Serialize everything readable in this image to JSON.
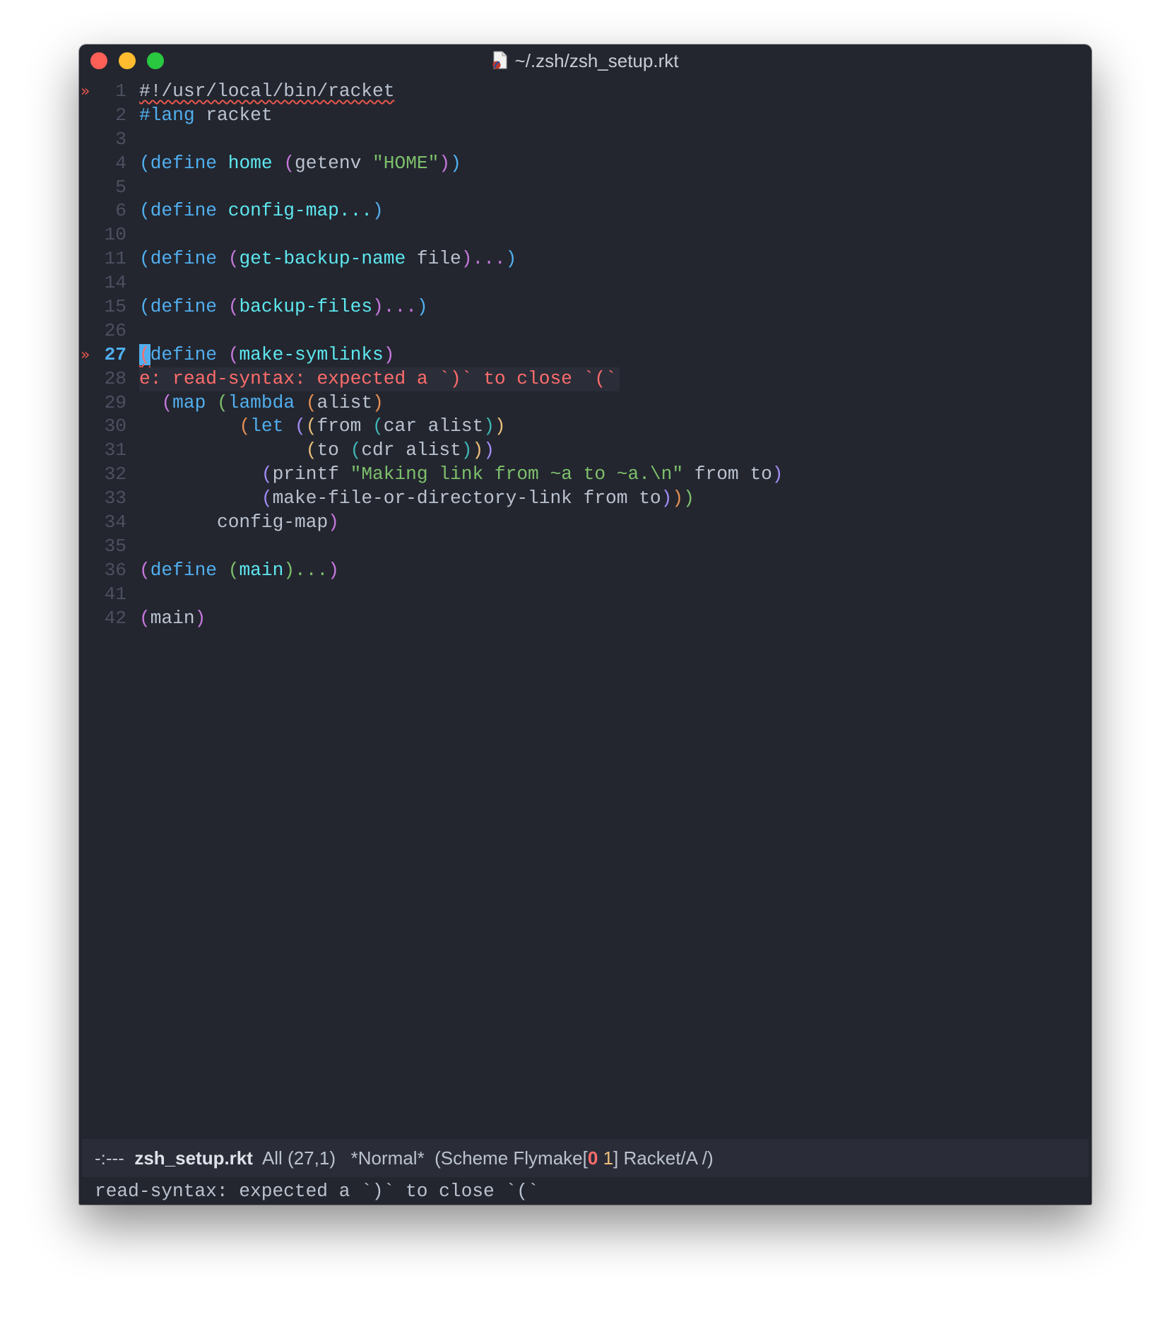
{
  "window": {
    "title": "~/.zsh/zsh_setup.rkt",
    "title_icon": "racket-file-icon",
    "controls": [
      "close",
      "minimize",
      "zoom"
    ]
  },
  "editor": {
    "fringe_marker": "»",
    "cursor": {
      "line": 27,
      "column": 1
    },
    "lines": [
      {
        "num": "1",
        "fringe": true,
        "tokens": [
          {
            "t": "#!/usr/local/bin/racket",
            "c": "c-plain squig"
          }
        ]
      },
      {
        "num": "2",
        "tokens": [
          {
            "t": "#lang",
            "c": "c-kw"
          },
          {
            "t": " racket",
            "c": "c-plain"
          }
        ]
      },
      {
        "num": "3",
        "tokens": []
      },
      {
        "num": "4",
        "tokens": [
          {
            "t": "(",
            "c": "p-blue"
          },
          {
            "t": "define",
            "c": "c-kw"
          },
          {
            "t": " home ",
            "c": "c-fn"
          },
          {
            "t": "(",
            "c": "p-purple"
          },
          {
            "t": "getenv ",
            "c": "c-plain"
          },
          {
            "t": "\"HOME\"",
            "c": "c-str"
          },
          {
            "t": ")",
            "c": "p-purple"
          },
          {
            "t": ")",
            "c": "p-blue"
          }
        ]
      },
      {
        "num": "5",
        "tokens": []
      },
      {
        "num": "6",
        "tokens": [
          {
            "t": "(",
            "c": "p-blue"
          },
          {
            "t": "define",
            "c": "c-kw"
          },
          {
            "t": " config-map...",
            "c": "c-fn"
          },
          {
            "t": ")",
            "c": "p-blue"
          }
        ]
      },
      {
        "num": "10",
        "tokens": []
      },
      {
        "num": "11",
        "tokens": [
          {
            "t": "(",
            "c": "p-blue"
          },
          {
            "t": "define ",
            "c": "c-kw"
          },
          {
            "t": "(",
            "c": "p-purple"
          },
          {
            "t": "get-backup-name",
            "c": "c-fn"
          },
          {
            "t": " file",
            "c": "c-plain"
          },
          {
            "t": ")...",
            "c": "p-purple"
          },
          {
            "t": ")",
            "c": "p-blue"
          }
        ]
      },
      {
        "num": "14",
        "tokens": []
      },
      {
        "num": "15",
        "tokens": [
          {
            "t": "(",
            "c": "p-blue"
          },
          {
            "t": "define ",
            "c": "c-kw"
          },
          {
            "t": "(",
            "c": "p-purple"
          },
          {
            "t": "backup-files",
            "c": "c-fn"
          },
          {
            "t": ")...",
            "c": "p-purple"
          },
          {
            "t": ")",
            "c": "p-blue"
          }
        ]
      },
      {
        "num": "26",
        "tokens": []
      },
      {
        "num": "27",
        "fringe": true,
        "current": true,
        "tokens": [
          {
            "t": "(",
            "c": "cursor squig"
          },
          {
            "t": "define ",
            "c": "c-kw"
          },
          {
            "t": "(",
            "c": "p-purple"
          },
          {
            "t": "make-symlinks",
            "c": "c-fn"
          },
          {
            "t": ")",
            "c": "p-purple"
          }
        ]
      },
      {
        "num": "28",
        "error_overlay": true,
        "tokens": [
          {
            "t": "e: read-syntax: expected a `)` to close `(`",
            "c": "c-err"
          }
        ]
      },
      {
        "num": "29",
        "tokens": [
          {
            "t": "  ",
            "c": "c-plain"
          },
          {
            "t": "(",
            "c": "p-purple"
          },
          {
            "t": "map ",
            "c": "c-kw"
          },
          {
            "t": "(",
            "c": "p-green"
          },
          {
            "t": "lambda ",
            "c": "c-kw"
          },
          {
            "t": "(",
            "c": "p-orange"
          },
          {
            "t": "alist",
            "c": "c-plain"
          },
          {
            "t": ")",
            "c": "p-orange"
          }
        ]
      },
      {
        "num": "30",
        "tokens": [
          {
            "t": "         ",
            "c": "c-plain"
          },
          {
            "t": "(",
            "c": "p-orange"
          },
          {
            "t": "let ",
            "c": "c-kw"
          },
          {
            "t": "(",
            "c": "p-lav"
          },
          {
            "t": "(",
            "c": "p-yellow"
          },
          {
            "t": "from ",
            "c": "c-plain"
          },
          {
            "t": "(",
            "c": "p-teal"
          },
          {
            "t": "car alist",
            "c": "c-plain"
          },
          {
            "t": ")",
            "c": "p-teal"
          },
          {
            "t": ")",
            "c": "p-yellow"
          }
        ]
      },
      {
        "num": "31",
        "tokens": [
          {
            "t": "               ",
            "c": "c-plain"
          },
          {
            "t": "(",
            "c": "p-yellow"
          },
          {
            "t": "to ",
            "c": "c-plain"
          },
          {
            "t": "(",
            "c": "p-teal"
          },
          {
            "t": "cdr alist",
            "c": "c-plain"
          },
          {
            "t": ")",
            "c": "p-teal"
          },
          {
            "t": ")",
            "c": "p-yellow"
          },
          {
            "t": ")",
            "c": "p-lav"
          }
        ]
      },
      {
        "num": "32",
        "tokens": [
          {
            "t": "           ",
            "c": "c-plain"
          },
          {
            "t": "(",
            "c": "p-lav"
          },
          {
            "t": "printf ",
            "c": "c-plain"
          },
          {
            "t": "\"Making link from ~a to ~a.\\n\"",
            "c": "c-str"
          },
          {
            "t": " from to",
            "c": "c-plain"
          },
          {
            "t": ")",
            "c": "p-lav"
          }
        ]
      },
      {
        "num": "33",
        "tokens": [
          {
            "t": "           ",
            "c": "c-plain"
          },
          {
            "t": "(",
            "c": "p-lav"
          },
          {
            "t": "make-file-or-directory-link from to",
            "c": "c-plain"
          },
          {
            "t": ")",
            "c": "p-lav"
          },
          {
            "t": ")",
            "c": "p-orange"
          },
          {
            "t": ")",
            "c": "p-green"
          }
        ]
      },
      {
        "num": "34",
        "tokens": [
          {
            "t": "       config-map",
            "c": "c-plain"
          },
          {
            "t": ")",
            "c": "p-purple"
          }
        ]
      },
      {
        "num": "35",
        "tokens": []
      },
      {
        "num": "36",
        "tokens": [
          {
            "t": "(",
            "c": "p-purple"
          },
          {
            "t": "define ",
            "c": "c-kw"
          },
          {
            "t": "(",
            "c": "p-green"
          },
          {
            "t": "main",
            "c": "c-fn"
          },
          {
            "t": ")...",
            "c": "p-green"
          },
          {
            "t": ")",
            "c": "p-purple"
          }
        ]
      },
      {
        "num": "41",
        "tokens": []
      },
      {
        "num": "42",
        "tokens": [
          {
            "t": "(",
            "c": "p-purple"
          },
          {
            "t": "main",
            "c": "c-plain"
          },
          {
            "t": ")",
            "c": "p-purple"
          }
        ]
      }
    ]
  },
  "modeline": {
    "status": "-:---",
    "buffer_name": "zsh_setup.rkt",
    "position": "All (27,1)",
    "state": "*Normal*",
    "modes_prefix": "(Scheme Flymake[",
    "error_count": "0",
    "warning_count": "1",
    "modes_suffix": "] Racket/A /)"
  },
  "echo_area": {
    "message": "read-syntax: expected a `)` to close `(`"
  }
}
